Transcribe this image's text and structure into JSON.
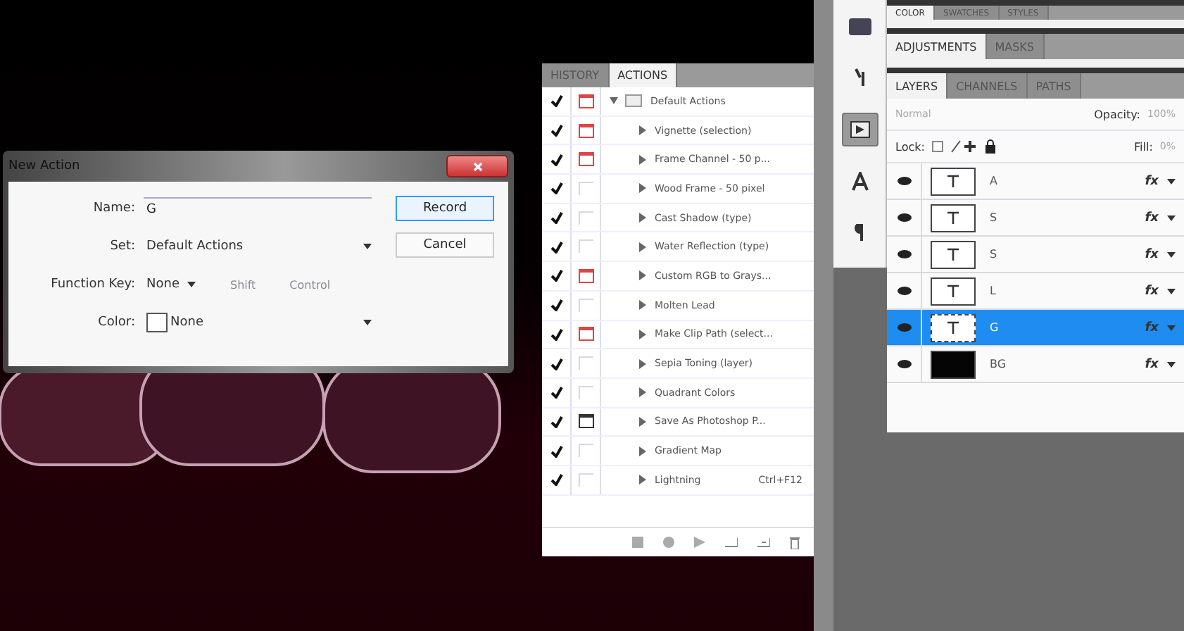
{
  "dialog": {
    "title": "New Action",
    "fields": [
      {
        "kind": "text",
        "label": "Name:",
        "value": "G"
      },
      {
        "kind": "select",
        "label": "Set:",
        "value": "Default Actions"
      },
      {
        "kind": "function_key",
        "label": "Function Key:",
        "value": "None",
        "options": [
          {
            "label": "Shift",
            "checked": false,
            "disabled": true
          },
          {
            "label": "Control",
            "checked": false,
            "disabled": true
          }
        ]
      },
      {
        "kind": "color",
        "label": "Color:",
        "value": "None"
      }
    ],
    "buttons": [
      {
        "label": "Record",
        "default": true
      },
      {
        "label": "Cancel",
        "default": false
      }
    ]
  },
  "actions_panel": {
    "tabs": [
      {
        "label": "HISTORY",
        "selected": false
      },
      {
        "label": "ACTIONS",
        "selected": true
      }
    ],
    "set": {
      "label": "Default Actions",
      "checked": true,
      "dialog_on": true,
      "dialog_partial": true,
      "expanded": true
    },
    "actions": [
      {
        "label": "Vignette (selection)",
        "checked": true,
        "dialog_on": true,
        "dialog_partial": true
      },
      {
        "label": "Frame Channel - 50 p...",
        "checked": true,
        "dialog_on": true,
        "dialog_partial": true
      },
      {
        "label": "Wood Frame - 50 pixel",
        "checked": true,
        "dialog_on": false
      },
      {
        "label": "Cast Shadow (type)",
        "checked": true,
        "dialog_on": false
      },
      {
        "label": "Water Reflection (type)",
        "checked": true,
        "dialog_on": false
      },
      {
        "label": "Custom RGB to Grays...",
        "checked": true,
        "dialog_on": true,
        "dialog_partial": true
      },
      {
        "label": "Molten Lead",
        "checked": true,
        "dialog_on": false
      },
      {
        "label": "Make Clip Path (select...",
        "checked": true,
        "dialog_on": true,
        "dialog_partial": true
      },
      {
        "label": "Sepia Toning (layer)",
        "checked": true,
        "dialog_on": false
      },
      {
        "label": "Quadrant Colors",
        "checked": true,
        "dialog_on": false
      },
      {
        "label": "Save As Photoshop P...",
        "checked": true,
        "dialog_on": true,
        "dialog_partial": false
      },
      {
        "label": "Gradient Map",
        "checked": true,
        "dialog_on": false
      },
      {
        "label": "Lightning",
        "checked": true,
        "dialog_on": false,
        "shortcut": "Ctrl+F12"
      }
    ]
  },
  "panel_groups": [
    {
      "tabs": [
        {
          "label": "COLOR",
          "selected": true
        },
        {
          "label": "SWATCHES",
          "selected": false
        },
        {
          "label": "STYLES",
          "selected": false
        }
      ]
    },
    {
      "tabs": [
        {
          "label": "ADJUSTMENTS",
          "selected": true
        },
        {
          "label": "MASKS",
          "selected": false
        }
      ]
    },
    {
      "tabs": [
        {
          "label": "LAYERS",
          "selected": true
        },
        {
          "label": "CHANNELS",
          "selected": false
        },
        {
          "label": "PATHS",
          "selected": false
        }
      ]
    }
  ],
  "layers_panel": {
    "blend_mode": "Normal",
    "opacity_label": "Opacity:",
    "opacity": "100%",
    "lock_label": "Lock:",
    "fill_label": "Fill:",
    "fill": "0%",
    "layers": [
      {
        "name": "A",
        "kind": "text",
        "visible": true,
        "selected": false,
        "effects": "fx"
      },
      {
        "name": "S",
        "kind": "text",
        "visible": true,
        "selected": false,
        "effects": "fx"
      },
      {
        "name": "S",
        "kind": "text",
        "visible": true,
        "selected": false,
        "effects": "fx"
      },
      {
        "name": "L",
        "kind": "text",
        "visible": true,
        "selected": false,
        "effects": "fx"
      },
      {
        "name": "G",
        "kind": "text",
        "visible": true,
        "selected": true,
        "effects": "fx"
      },
      {
        "name": "BG",
        "kind": "fill",
        "visible": true,
        "selected": false,
        "effects": "fx"
      }
    ]
  }
}
